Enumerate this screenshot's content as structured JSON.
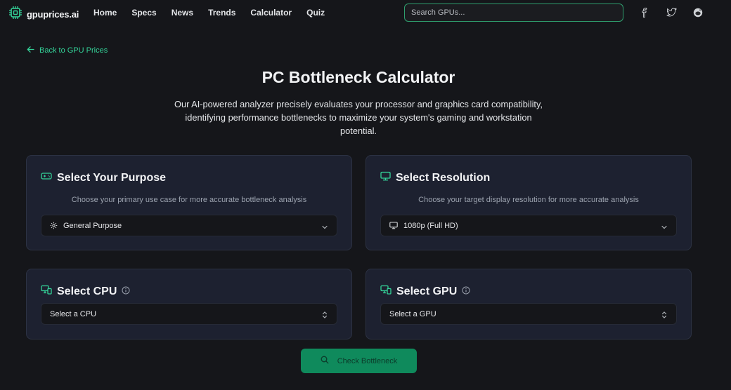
{
  "brand": {
    "name": "gpuprices.ai",
    "accent": "#34d399"
  },
  "nav": {
    "links": [
      "Home",
      "Specs",
      "News",
      "Trends",
      "Calculator",
      "Quiz"
    ]
  },
  "search": {
    "placeholder": "Search GPUs..."
  },
  "social": [
    "facebook-icon",
    "twitter-icon",
    "reddit-icon"
  ],
  "back_link": "Back to GPU Prices",
  "page": {
    "title": "PC Bottleneck Calculator",
    "description": "Our AI-powered analyzer precisely evaluates your processor and graphics card compatibility, identifying performance bottlenecks to maximize your system's gaming and workstation potential."
  },
  "purpose": {
    "title": "Select Your Purpose",
    "subtitle": "Choose your primary use case for more accurate bottleneck analysis",
    "selected": "General Purpose"
  },
  "resolution": {
    "title": "Select Resolution",
    "subtitle": "Choose your target display resolution for more accurate analysis",
    "selected": "1080p (Full HD)"
  },
  "cpu": {
    "title": "Select CPU",
    "placeholder": "Select a CPU"
  },
  "gpu": {
    "title": "Select GPU",
    "placeholder": "Select a GPU"
  },
  "actions": {
    "check": "Check Bottleneck"
  }
}
